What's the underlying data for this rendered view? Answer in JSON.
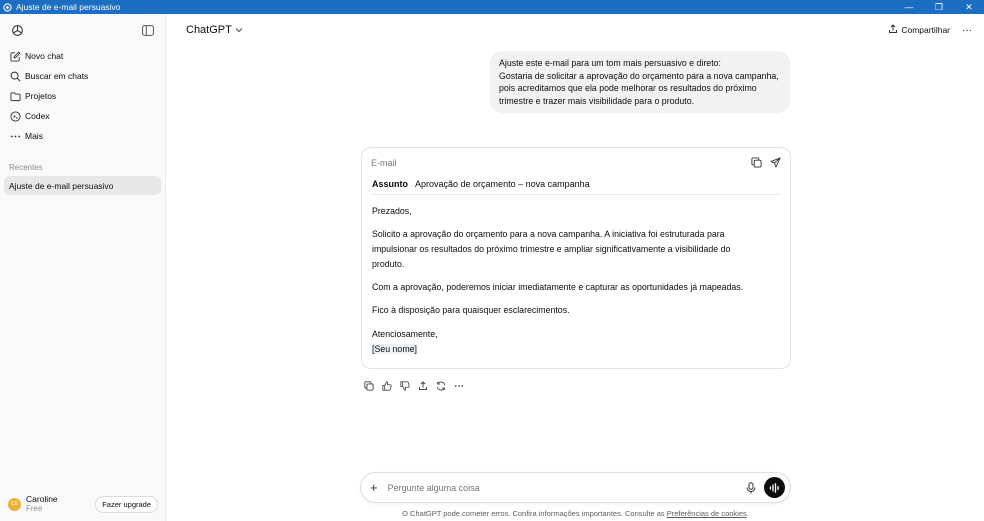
{
  "window": {
    "title": "Ajuste de e-mail persuasivo",
    "controls": {
      "minimize": "—",
      "maximize": "❐",
      "close": "✕"
    }
  },
  "sidebar": {
    "items": [
      {
        "label": "Novo chat",
        "icon": "new-chat-icon"
      },
      {
        "label": "Buscar em chats",
        "icon": "search-icon"
      },
      {
        "label": "Projetos",
        "icon": "folder-icon"
      },
      {
        "label": "Codex",
        "icon": "codex-icon"
      },
      {
        "label": "Mais",
        "icon": "more-icon"
      }
    ],
    "section_title": "Recentes",
    "chats": [
      "Ajuste de e-mail persuasivo"
    ],
    "user": {
      "initials": "CE",
      "name": "Caroline",
      "plan": "Free",
      "upgrade_label": "Fazer upgrade"
    }
  },
  "header": {
    "model": "ChatGPT",
    "share_label": "Compartilhar",
    "more": "···"
  },
  "conversation": {
    "user_message": [
      "Ajuste este e-mail para um tom mais persuasivo e direto:",
      "Gostaria de solicitar a aprovação do orçamento para a nova campanha,",
      "pois acreditamos que ela pode melhorar os resultados do próximo",
      "trimestre e trazer mais visibilidade para o produto."
    ],
    "email": {
      "label": "E-mail",
      "subject_label": "Assunto",
      "subject": "Aprovação de orçamento – nova campanha",
      "greeting": "Prezados,",
      "paragraph1_lines": [
        "Solicito a aprovação do orçamento para a nova campanha. A iniciativa foi estruturada para",
        "impulsionar os resultados do próximo trimestre e ampliar significativamente a visibilidade do",
        "produto."
      ],
      "paragraph2": "Com a aprovação, poderemos iniciar imediatamente e capturar as oportunidades já mapeadas.",
      "paragraph3": "Fico à disposição para quaisquer esclarecimentos.",
      "closing": "Atenciosamente,",
      "signature": "[Seu nome]"
    }
  },
  "composer": {
    "placeholder": "Pergunte alguma coisa",
    "plus": "+"
  },
  "footer": {
    "text": "O ChatGPT pode cometer erros. Confira informações importantes. Consulte as ",
    "link": "Preferências de cookies",
    "end": "."
  },
  "colors": {
    "titlebar": "#1b6ec2",
    "sidebar_bg": "#f9f9f9",
    "user_bubble": "#f2f2f2",
    "avatar": "#e9b33a"
  }
}
